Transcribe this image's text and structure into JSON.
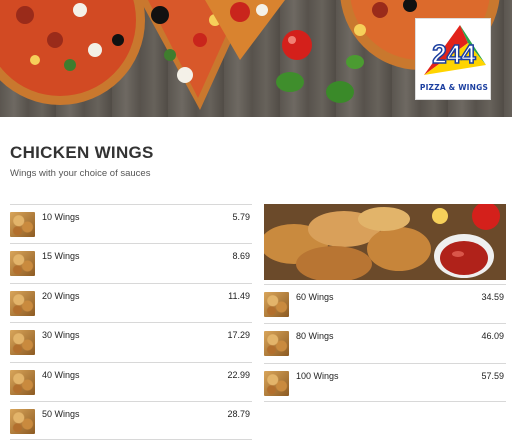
{
  "hero": {
    "logo_number": "244",
    "logo_tagline": "PIZZA & WINGS",
    "logo_icon": "pizza-wings-logo-icon"
  },
  "section": {
    "title": "CHICKEN WINGS",
    "subtitle": "Wings with your choice of sauces"
  },
  "menu_left": [
    {
      "name": "10 Wings",
      "price": "5.79"
    },
    {
      "name": "15 Wings",
      "price": "8.69"
    },
    {
      "name": "20 Wings",
      "price": "11.49"
    },
    {
      "name": "30 Wings",
      "price": "17.29"
    },
    {
      "name": "40 Wings",
      "price": "22.99"
    },
    {
      "name": "50 Wings",
      "price": "28.79"
    }
  ],
  "menu_right": [
    {
      "name": "60 Wings",
      "price": "34.59"
    },
    {
      "name": "80 Wings",
      "price": "46.09"
    },
    {
      "name": "100 Wings",
      "price": "57.59"
    }
  ],
  "colors": {
    "logo_red": "#e2231a",
    "logo_green": "#2aa64a",
    "logo_yellow": "#ffd400",
    "logo_blue": "#1b3fa0"
  }
}
